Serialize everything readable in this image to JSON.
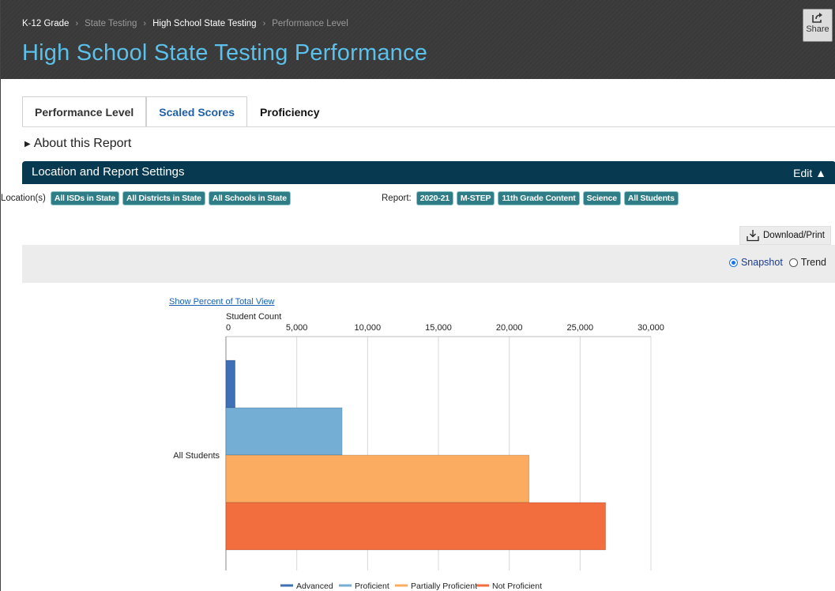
{
  "header": {
    "breadcrumb": [
      "K-12 Grade",
      "State Testing",
      "High School State Testing",
      "Performance Level"
    ],
    "title": "High School State Testing Performance",
    "share_label": "Share"
  },
  "tabs": [
    {
      "label": "Performance Level"
    },
    {
      "label": "Scaled Scores"
    },
    {
      "label": "Proficiency"
    }
  ],
  "about_label": "About this Report",
  "settings": {
    "title": "Location and Report Settings",
    "edit_label": "Edit ▲",
    "locations_label": "Location(s)",
    "locations": [
      "All ISDs in State",
      "All Districts in State",
      "All Schools in State"
    ],
    "report_label": "Report:",
    "report": [
      "2020-21",
      "M-STEP",
      "11th Grade Content",
      "Science",
      "All Students"
    ]
  },
  "download_label": "Download/Print",
  "view_options": {
    "snapshot": "Snapshot",
    "trend": "Trend",
    "selected": "Snapshot"
  },
  "show_percent_link": "Show Percent of Total View",
  "colors": {
    "advanced": "#3f6fb5",
    "proficient": "#74aed5",
    "partially": "#fcac60",
    "not_proficient": "#f36e3f"
  },
  "chart_data": {
    "type": "bar",
    "orientation": "horizontal",
    "categories": [
      "All Students"
    ],
    "series": [
      {
        "name": "Advanced",
        "values": [
          650
        ]
      },
      {
        "name": "Proficient",
        "values": [
          8200
        ]
      },
      {
        "name": "Partially Proficient",
        "values": [
          21400
        ]
      },
      {
        "name": "Not Proficient",
        "values": [
          26800
        ]
      }
    ],
    "xlabel": "Student Count",
    "xlim": [
      0,
      30000
    ],
    "ticks": [
      "0",
      "5,000",
      "10,000",
      "15,000",
      "20,000",
      "25,000",
      "30,000"
    ],
    "tick_values": [
      0,
      5000,
      10000,
      15000,
      20000,
      25000,
      30000
    ],
    "grid": true,
    "legend": "bottom"
  }
}
